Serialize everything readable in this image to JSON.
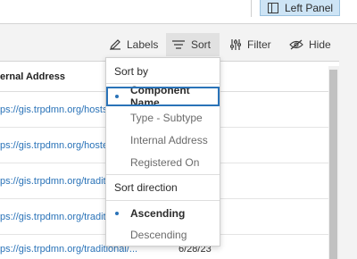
{
  "topbar": {
    "left_panel_label": "Left Panel",
    "left_panel_icon": "panel-left-icon"
  },
  "toolbar": {
    "labels_label": "Labels",
    "labels_icon": "pencil-icon",
    "sort_label": "Sort",
    "sort_icon": "sort-lines-icon",
    "filter_label": "Filter",
    "filter_icon": "sliders-icon",
    "hide_label": "Hide",
    "hide_icon": "eye-slash-icon"
  },
  "table": {
    "column_header": "ernal Address",
    "rows": [
      {
        "address": "ps://gis.trpdmn.org/hosts",
        "date": ""
      },
      {
        "address": "ps://gis.trpdmn.org/hosted",
        "date": ""
      },
      {
        "address": "ps://gis.trpdmn.org/tradit",
        "date": ""
      },
      {
        "address": "ps://gis.trpdmn.org/tradit",
        "date": ""
      },
      {
        "address": "ps://gis.trpdmn.org/traditional/...",
        "date": "6/28/23"
      }
    ]
  },
  "sort_menu": {
    "sort_by_heading": "Sort by",
    "sort_by_options": [
      {
        "label": "Component Name",
        "selected": true
      },
      {
        "label": "Type - Subtype",
        "selected": false
      },
      {
        "label": "Internal Address",
        "selected": false
      },
      {
        "label": "Registered On",
        "selected": false
      }
    ],
    "direction_heading": "Sort direction",
    "direction_options": [
      {
        "label": "Ascending",
        "selected": true
      },
      {
        "label": "Descending",
        "selected": false
      }
    ]
  },
  "colors": {
    "accent": "#2a73b8",
    "left_panel_bg": "#cde4f5",
    "link": "#2a73b8"
  }
}
